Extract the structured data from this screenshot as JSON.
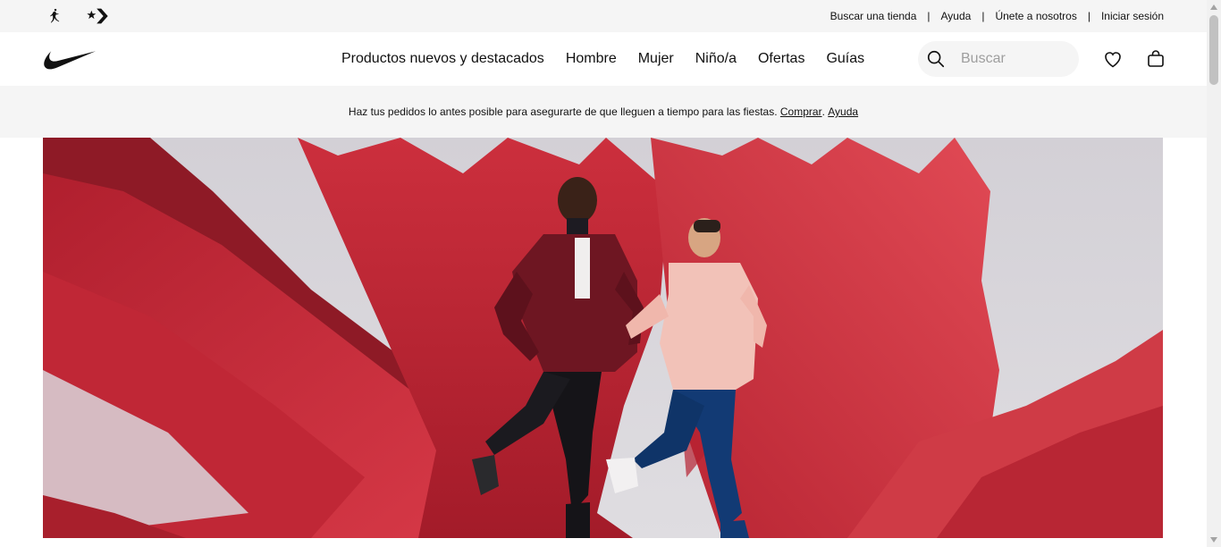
{
  "brands": {
    "jordan_icon": "jordan-jumpman-icon",
    "converse_icon": "converse-star-chevron-icon"
  },
  "utility": {
    "find_store": "Buscar una tienda",
    "help": "Ayuda",
    "join": "Únete a nosotros",
    "sign_in": "Iniciar sesión",
    "separator": "|"
  },
  "nav": {
    "logo_icon": "nike-swoosh-icon",
    "items": [
      {
        "label": "Productos nuevos y destacados"
      },
      {
        "label": "Hombre"
      },
      {
        "label": "Mujer"
      },
      {
        "label": "Niño/a"
      },
      {
        "label": "Ofertas"
      },
      {
        "label": "Guías"
      }
    ],
    "search": {
      "placeholder": "Buscar",
      "value": ""
    },
    "favorites_icon": "heart-icon",
    "bag_icon": "bag-icon"
  },
  "promo": {
    "text": "Haz tus pedidos lo antes posible para asegurarte de que lleguen a tiempo para las fiestas.",
    "shop_link": "Comprar",
    "dot": ".",
    "help_link": "Ayuda"
  },
  "hero": {
    "description_icon": "hero-runners-image",
    "colors": {
      "paper": "#c8283a",
      "paper_dark": "#8e1a26",
      "backdrop": "#d9d6db"
    }
  }
}
